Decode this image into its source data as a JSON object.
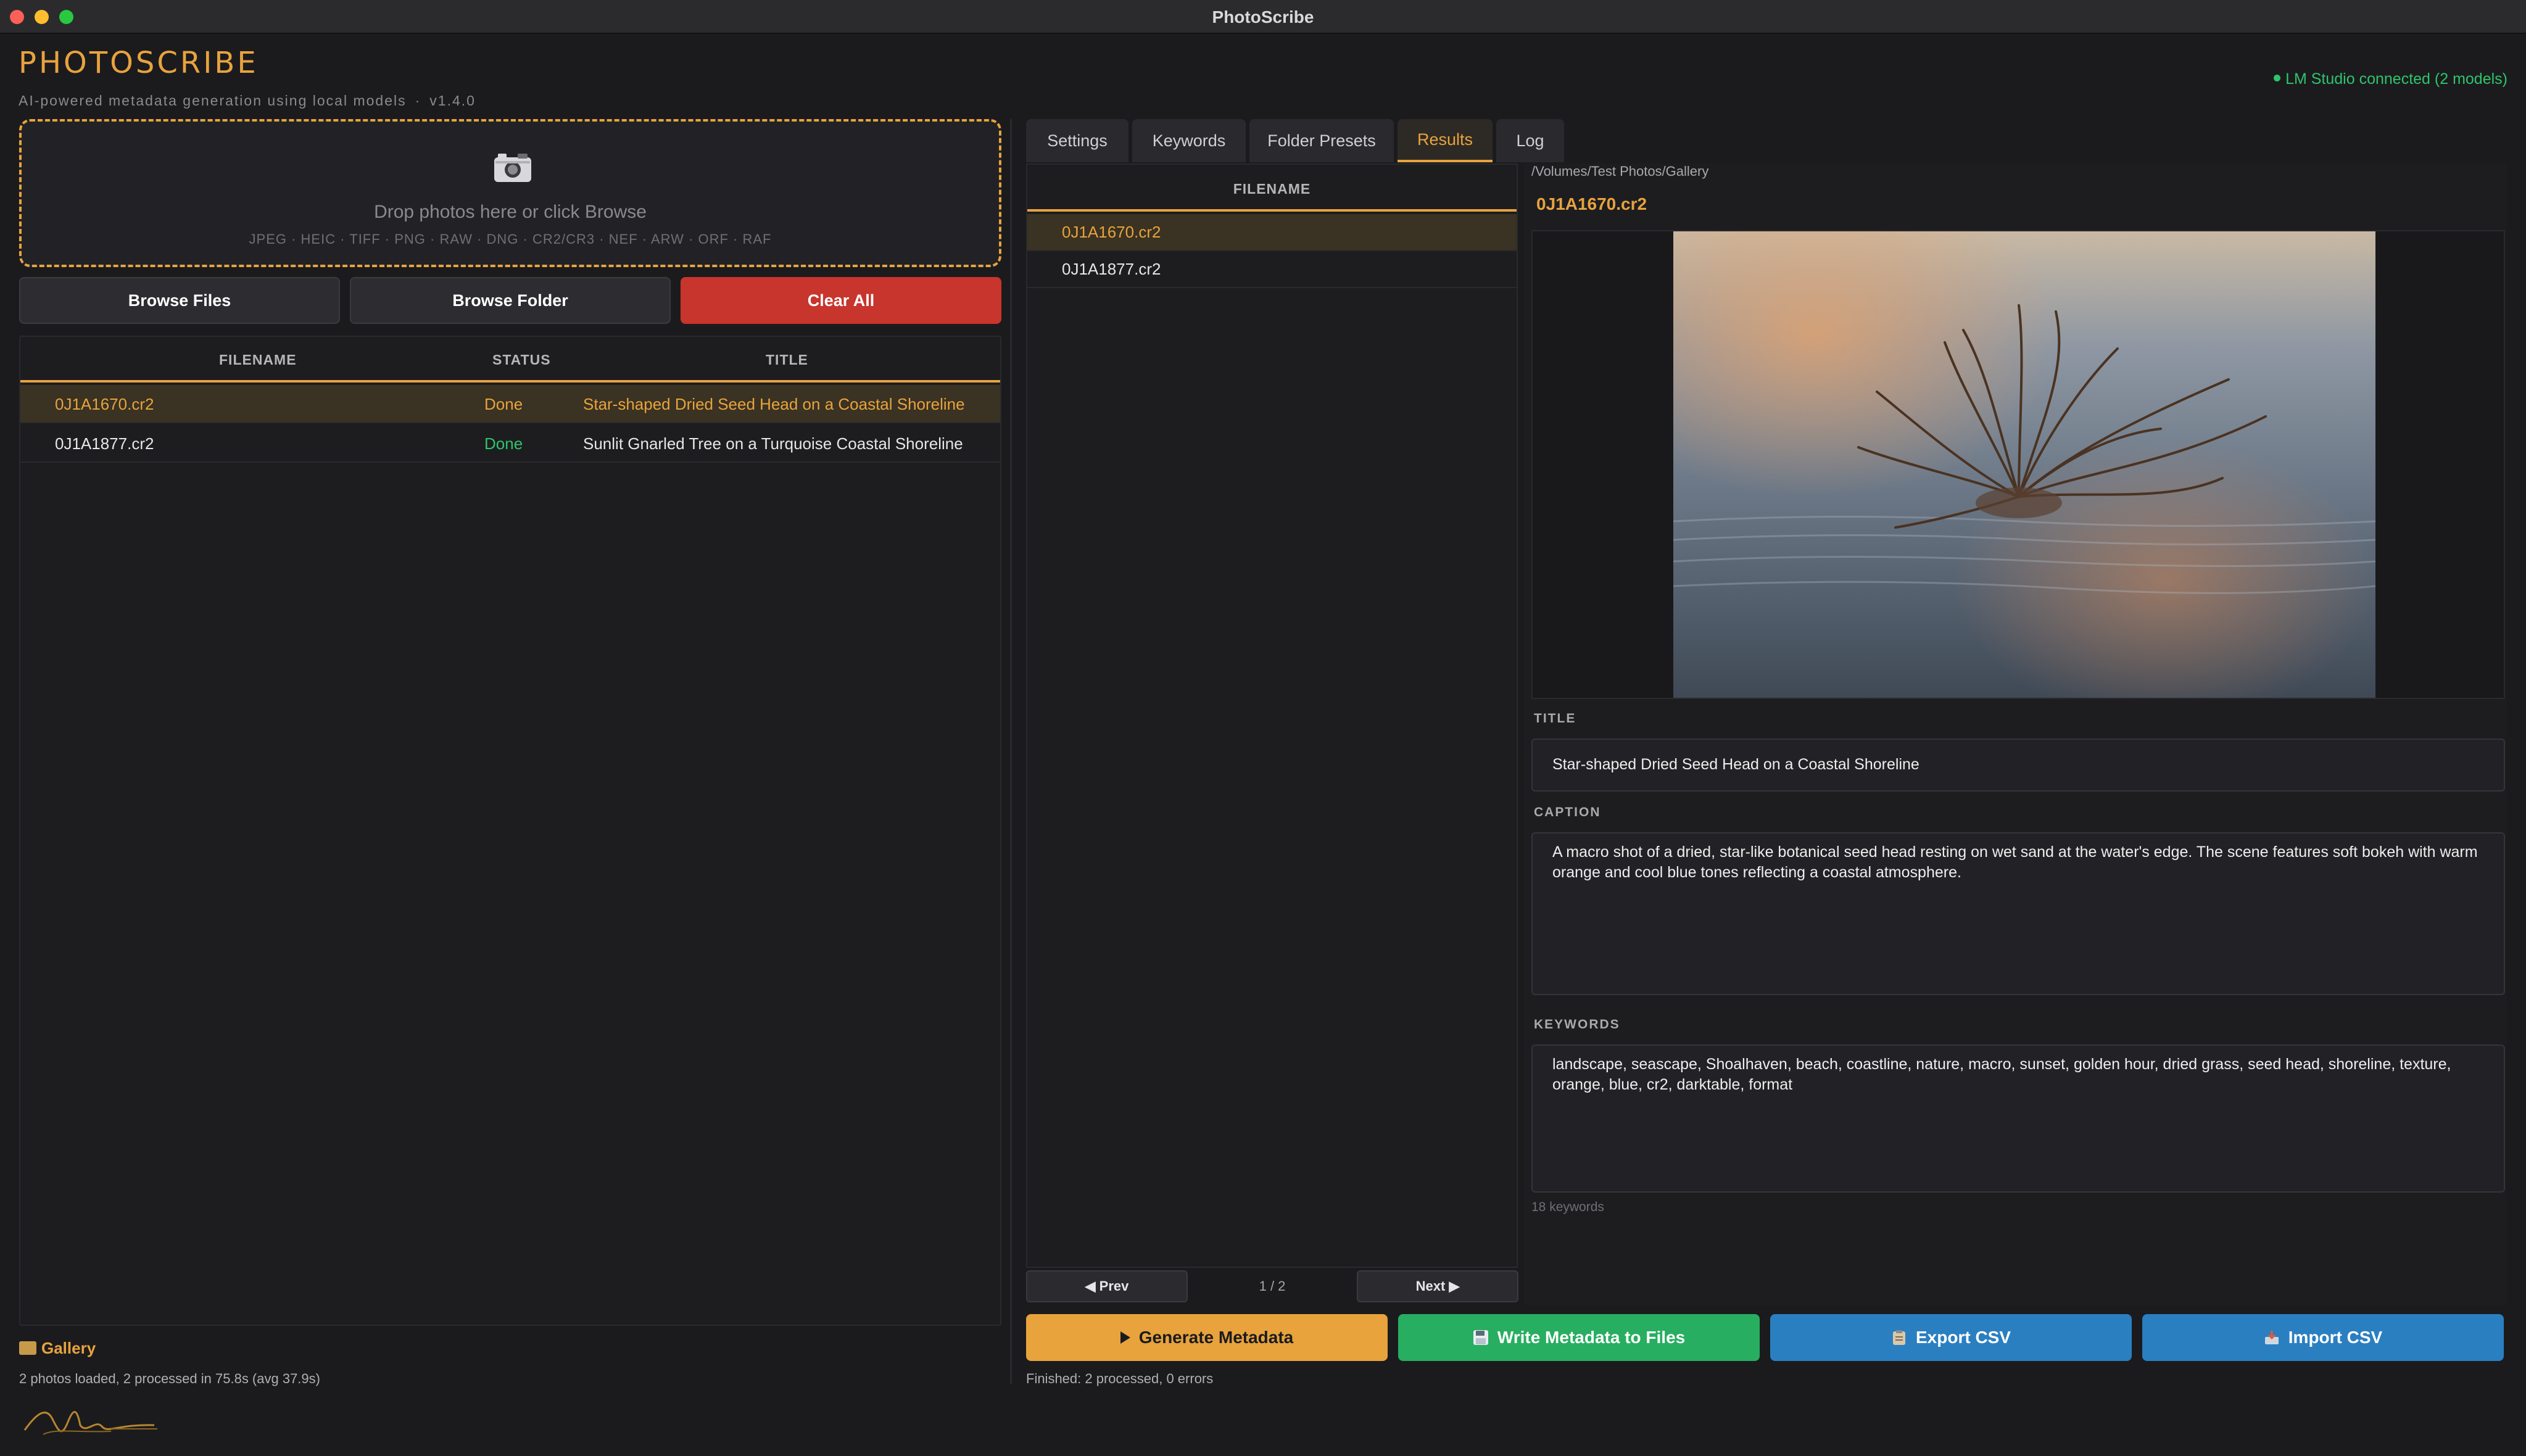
{
  "window": {
    "title": "PhotoScribe"
  },
  "header": {
    "app_name": "PHOTOSCRIBE",
    "subtitle": "AI-powered metadata generation using local models",
    "version": "v1.4.0",
    "separator": "·",
    "status": "LM Studio connected (2 models)"
  },
  "dropzone": {
    "text": "Drop photos here or click Browse",
    "formats": "JPEG · HEIC · TIFF · PNG · RAW · DNG · CR2/CR3 · NEF · ARW · ORF · RAF",
    "icon": "camera-icon"
  },
  "buttons": {
    "browse_files": "Browse Files",
    "browse_folder": "Browse Folder",
    "clear_all": "Clear All"
  },
  "file_table": {
    "columns": [
      "FILENAME",
      "STATUS",
      "TITLE"
    ],
    "rows": [
      {
        "filename": "0J1A1670.cr2",
        "status": "Done",
        "title": "Star-shaped Dried Seed Head on a Coastal Shoreline"
      },
      {
        "filename": "0J1A1877.cr2",
        "status": "Done",
        "title": "Sunlit Gnarled Tree on a Turquoise Coastal Shoreline"
      }
    ]
  },
  "left_footer": {
    "gallery": "Gallery",
    "summary": "2 photos loaded, 2 processed in 75.8s (avg 37.9s)"
  },
  "tabs": [
    "Settings",
    "Keywords",
    "Folder Presets",
    "Results",
    "Log"
  ],
  "results": {
    "header": "FILENAME",
    "files": [
      "0J1A1670.cr2",
      "0J1A1877.cr2"
    ],
    "pager": {
      "prev": "◀ Prev",
      "count": "1 / 2",
      "next": "Next ▶"
    }
  },
  "detail": {
    "path": "/Volumes/Test Photos/Gallery",
    "filename": "0J1A1670.cr2",
    "title_label": "TITLE",
    "title": "Star-shaped Dried Seed Head on a Coastal Shoreline",
    "caption_label": "CAPTION",
    "caption": "A macro shot of a dried, star-like botanical seed head resting on wet sand at the water's edge. The scene features soft bokeh with warm orange and cool blue tones reflecting a coastal atmosphere.",
    "keywords_label": "KEYWORDS",
    "keywords": "landscape, seascape, Shoalhaven, beach, coastline, nature, macro, sunset, golden hour, dried grass, seed head, shoreline, texture, orange, blue, cr2, darktable, format",
    "keyword_count": "18 keywords"
  },
  "actions": {
    "generate": "Generate Metadata",
    "write": "Write Metadata to Files",
    "export": "Export CSV",
    "import": "Import CSV"
  },
  "status_footer": "Finished: 2 processed, 0 errors",
  "colors": {
    "accent": "#e8a33d",
    "green": "#27ae60",
    "blue": "#2a7fc1",
    "red": "#c8352c",
    "status_green": "#2fc46a"
  }
}
